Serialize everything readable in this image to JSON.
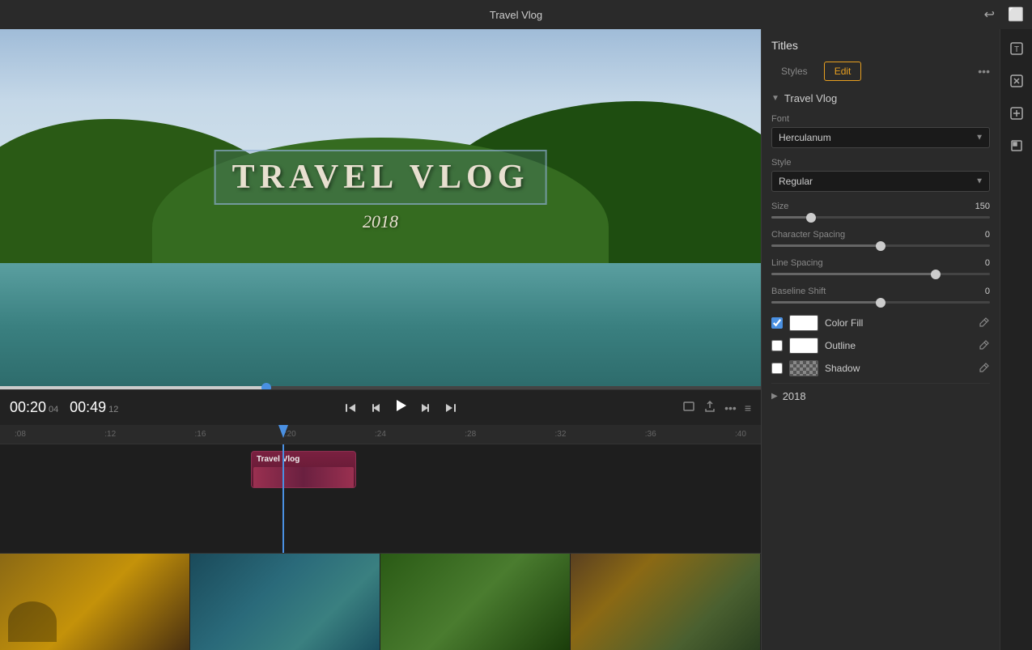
{
  "topbar": {
    "title": "Travel Vlog",
    "undo_icon": "↩",
    "chat_icon": "💬"
  },
  "video": {
    "title_text": "TRAVEL VLOG",
    "year_text": "2018",
    "scrubber_progress": "35"
  },
  "playback": {
    "time_current": "00:20",
    "time_frame": "04",
    "time_total": "00:49",
    "time_total_frame": "12",
    "btn_skip_back": "⏮",
    "btn_step_back": "⏴",
    "btn_play": "▶",
    "btn_step_fwd": "⏵",
    "btn_skip_fwd": "⏭"
  },
  "timeline": {
    "ruler_marks": [
      ":08",
      ":12",
      ":16",
      ":20",
      ":24",
      ":28",
      ":32",
      ":36",
      ":40"
    ],
    "clip_label": "Travel Vlog"
  },
  "sidebar_icons": {
    "icon1": "T",
    "icon2": "✕",
    "icon3": "⊕",
    "icon4": "⬡"
  },
  "titles_panel": {
    "title": "Titles",
    "tab_styles": "Styles",
    "tab_edit": "Edit",
    "more_icon": "•••",
    "section_travel_vlog": "Travel Vlog",
    "font_label": "Font",
    "font_value": "Herculanum",
    "style_label": "Style",
    "style_value": "Regular",
    "size_label": "Size",
    "size_value": "150",
    "size_slider_pos": "18",
    "char_spacing_label": "Character Spacing",
    "char_spacing_value": "0",
    "char_spacing_pos": "50",
    "line_spacing_label": "Line Spacing",
    "line_spacing_value": "0",
    "line_spacing_pos": "75",
    "baseline_shift_label": "Baseline Shift",
    "baseline_shift_value": "0",
    "baseline_shift_pos": "50",
    "color_fill_label": "Color Fill",
    "outline_label": "Outline",
    "shadow_label": "Shadow",
    "section_2018": "2018"
  }
}
